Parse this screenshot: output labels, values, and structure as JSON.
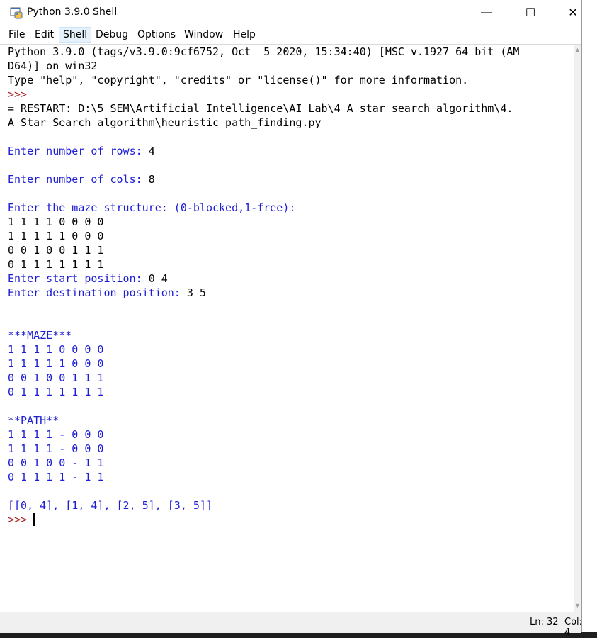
{
  "window": {
    "title": "Python 3.9.0 Shell",
    "minimize": "—",
    "maximize": "☐",
    "close": "✕"
  },
  "menu": [
    "File",
    "Edit",
    "Shell",
    "Debug",
    "Options",
    "Window",
    "Help"
  ],
  "lines": [
    {
      "t": "Python 3.9.0 (tags/v3.9.0:9cf6752, Oct  5 2020, 15:34:40) [MSC v.1927 64 bit (AM",
      "c": "out"
    },
    {
      "t": "D64)] on win32",
      "c": "out"
    },
    {
      "t": "Type \"help\", \"copyright\", \"credits\" or \"license()\" for more information.",
      "c": "out"
    },
    {
      "t": ">>> ",
      "c": "prompt"
    },
    {
      "t": "= RESTART: D:\\5 SEM\\Artificial Intelligence\\AI Lab\\4 A star search algorithm\\4.",
      "c": "out"
    },
    {
      "t": "A Star Search algorithm\\heuristic path_finding.py",
      "c": "out"
    },
    {
      "t": "",
      "c": "out"
    },
    {
      "parts": [
        {
          "t": "Enter number of rows: ",
          "c": "stdout"
        },
        {
          "t": "4",
          "c": "input"
        }
      ]
    },
    {
      "t": "",
      "c": "out"
    },
    {
      "parts": [
        {
          "t": "Enter number of cols: ",
          "c": "stdout"
        },
        {
          "t": "8",
          "c": "input"
        }
      ]
    },
    {
      "t": "",
      "c": "out"
    },
    {
      "t": "Enter the maze structure: (0-blocked,1-free):",
      "c": "stdout"
    },
    {
      "t": "1 1 1 1 0 0 0 0",
      "c": "input"
    },
    {
      "t": "1 1 1 1 1 0 0 0",
      "c": "input"
    },
    {
      "t": "0 0 1 0 0 1 1 1",
      "c": "input"
    },
    {
      "t": "0 1 1 1 1 1 1 1",
      "c": "input"
    },
    {
      "parts": [
        {
          "t": "Enter start position: ",
          "c": "stdout"
        },
        {
          "t": "0 4",
          "c": "input"
        }
      ]
    },
    {
      "parts": [
        {
          "t": "Enter destination position: ",
          "c": "stdout"
        },
        {
          "t": "3 5",
          "c": "input"
        }
      ]
    },
    {
      "t": "",
      "c": "out"
    },
    {
      "t": "",
      "c": "out"
    },
    {
      "t": "***MAZE***",
      "c": "stdout"
    },
    {
      "t": "1 1 1 1 0 0 0 0",
      "c": "stdout"
    },
    {
      "t": "1 1 1 1 1 0 0 0",
      "c": "stdout"
    },
    {
      "t": "0 0 1 0 0 1 1 1",
      "c": "stdout"
    },
    {
      "t": "0 1 1 1 1 1 1 1",
      "c": "stdout"
    },
    {
      "t": "",
      "c": "out"
    },
    {
      "t": "**PATH**",
      "c": "stdout"
    },
    {
      "t": "1 1 1 1 - 0 0 0",
      "c": "stdout"
    },
    {
      "t": "1 1 1 1 - 0 0 0",
      "c": "stdout"
    },
    {
      "t": "0 0 1 0 0 - 1 1",
      "c": "stdout"
    },
    {
      "t": "0 1 1 1 1 - 1 1",
      "c": "stdout"
    },
    {
      "t": "",
      "c": "out"
    },
    {
      "t": "[[0, 4], [1, 4], [2, 5], [3, 5]]",
      "c": "stdout"
    },
    {
      "t": ">>> ",
      "c": "prompt"
    }
  ],
  "status": {
    "ln": "Ln: 32",
    "col": "Col: 4"
  },
  "colors": {
    "prompt": "#a52a2a",
    "stdout": "#1d1dd6",
    "text": "#000000"
  }
}
